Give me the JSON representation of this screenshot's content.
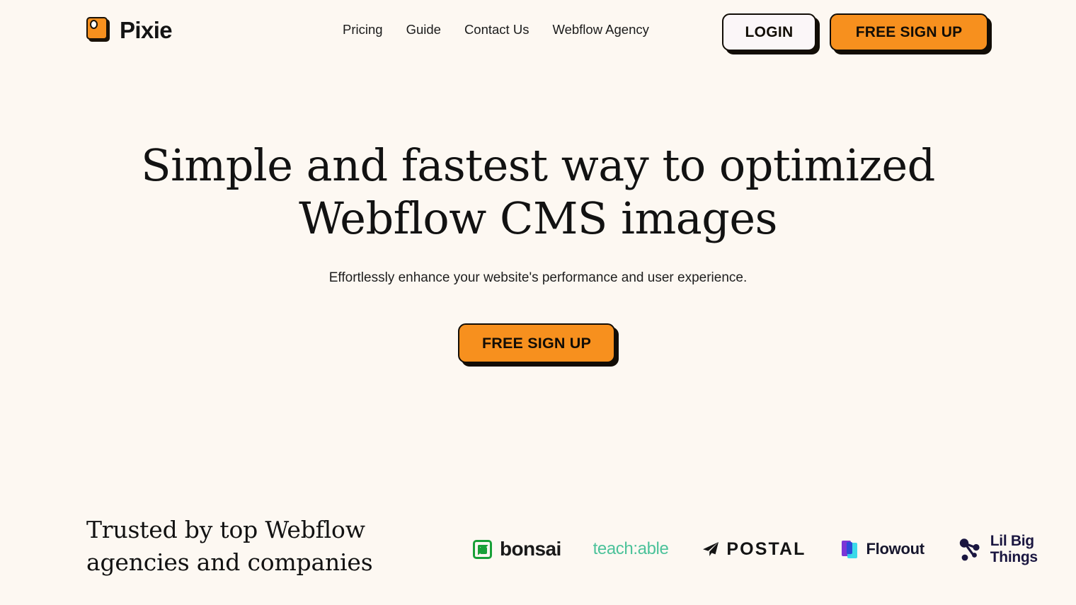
{
  "brand": {
    "name": "Pixie",
    "mark_icon": "pixie-square-icon"
  },
  "nav": {
    "items": [
      {
        "label": "Pricing"
      },
      {
        "label": "Guide"
      },
      {
        "label": "Contact Us"
      },
      {
        "label": "Webflow Agency"
      }
    ],
    "login_label": "LOGIN",
    "signup_label": "FREE SIGN UP"
  },
  "hero": {
    "title_line1": "Simple and fastest way to optimized",
    "title_line2": "Webflow CMS images",
    "subtitle": "Effortlessly enhance your website's performance and user experience.",
    "cta_label": "FREE SIGN UP"
  },
  "trusted": {
    "heading_line1": "Trusted by top Webflow",
    "heading_line2": "agencies and companies",
    "logos": [
      {
        "name": "bonsai",
        "label": "bonsai",
        "icon": "bonsai-spiral-icon",
        "color": "#18A038"
      },
      {
        "name": "teachable",
        "label": "teach:able",
        "icon": "",
        "color": "#4CC29A"
      },
      {
        "name": "postal",
        "label": "POSTAL",
        "icon": "paper-plane-icon",
        "color": "#141414"
      },
      {
        "name": "flowout",
        "label": "Flowout",
        "icon": "flowout-cards-icon",
        "color": "#17172E"
      },
      {
        "name": "lil-big-things",
        "label_line1": "Lil Big",
        "label_line2": "Things",
        "icon": "molecule-nodes-icon",
        "color": "#1A1640"
      }
    ]
  },
  "theme": {
    "background": "#FDF8F2",
    "accent_orange": "#F7901E",
    "ink": "#120D06",
    "login_bg": "#FBF6F8"
  }
}
